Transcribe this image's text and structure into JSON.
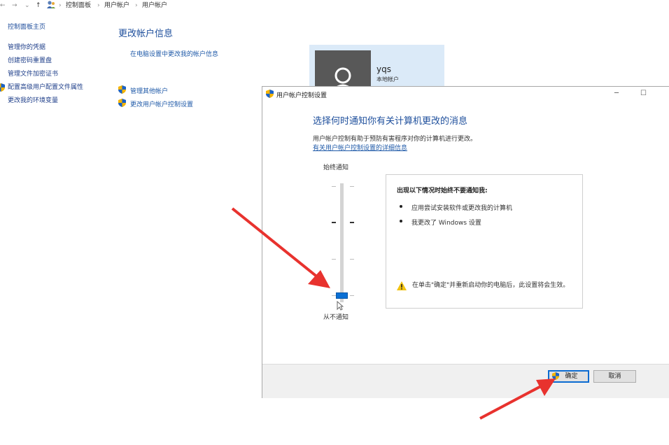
{
  "address_bar": {
    "back": "←",
    "forward": "→",
    "history": "⌄",
    "up": "↑",
    "crumbs": [
      "控制面板",
      "用户帐户",
      "用户帐户"
    ],
    "separator": "›"
  },
  "left_nav": {
    "home": "控制面板主页",
    "items": [
      "管理你的凭据",
      "创建密码重置盘",
      "管理文件加密证书",
      "配置高级用户配置文件属性",
      "更改我的环境变量"
    ]
  },
  "main": {
    "title": "更改帐户信息",
    "pc_settings_link": "在电脑设置中更改我的帐户信息",
    "links": [
      "管理其他帐户",
      "更改用户帐户控制设置"
    ]
  },
  "account": {
    "name": "yqs",
    "type": "本地帐户"
  },
  "dialog": {
    "title": "用户帐户控制设置",
    "minimize": "─",
    "maximize": "☐",
    "heading": "选择何时通知你有关计算机更改的消息",
    "description": "用户帐户控制有助于预防有害程序对你的计算机进行更改。",
    "link": "有关用户帐户控制设置的详细信息",
    "slider_top_label": "始终通知",
    "slider_bottom_label": "从不通知",
    "slider_level": 0,
    "slider_levels_count": 4,
    "info_title": "出现以下情况时始终不要通知我:",
    "info_items": [
      "应用尝试安装软件或更改我的计算机",
      "我更改了 Windows 设置"
    ],
    "warning": "在单击\"确定\"并重新启动你的电脑后，此设置将会生效。",
    "ok": "确定",
    "cancel": "取消"
  },
  "colors": {
    "accent": "#0a6fd4",
    "link": "#1f5aa8",
    "heading": "#1e4f9c",
    "arrow": "#e8322e"
  }
}
